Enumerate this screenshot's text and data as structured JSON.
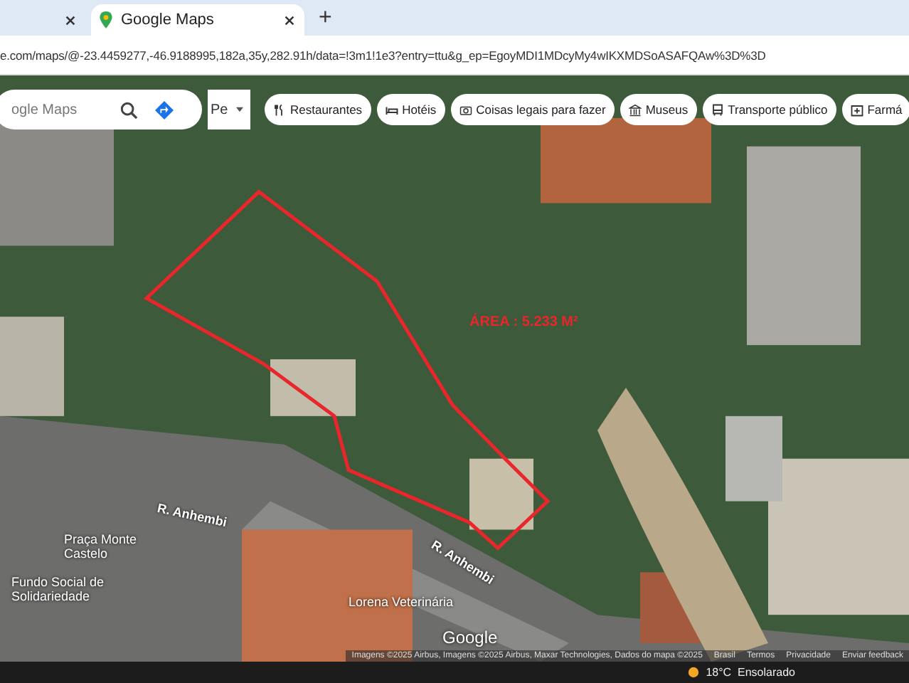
{
  "browser": {
    "tabs": [
      {
        "selected": false
      },
      {
        "title": "Google Maps",
        "selected": true
      }
    ],
    "new_tab": "+",
    "url": "e.com/maps/@-23.4459277,-46.9188995,182a,35y,282.91h/data=!3m1!1e3?entry=ttu&g_ep=EgoyMDI1MDcyMy4wIKXMDSoASAFQAw%3D%3D"
  },
  "map": {
    "search": {
      "placeholder": "ogle Maps"
    },
    "layer_button": "Pe",
    "chips": [
      {
        "label": "Restaurantes",
        "kind": "fork"
      },
      {
        "label": "Hotéis",
        "kind": "bed"
      },
      {
        "label": "Coisas legais para fazer",
        "kind": "camera"
      },
      {
        "label": "Museus",
        "kind": "museum"
      },
      {
        "label": "Transporte público",
        "kind": "bus"
      },
      {
        "label": "Farmá",
        "kind": "pharmacy"
      }
    ],
    "area_label": "ÁREA : 5.233 M²",
    "labels": [
      {
        "text": "R. Anhembi",
        "kind": "street"
      },
      {
        "text": "R. Anhembi",
        "kind": "street"
      },
      {
        "text": "Praça Monte Castelo",
        "kind": "place"
      },
      {
        "text": "Fundo Social de Solidariedade",
        "kind": "poi"
      },
      {
        "text": "Lorena Veterinária",
        "kind": "poi"
      }
    ],
    "logo": "Google",
    "footer": [
      "Imagens ©2025 Airbus, Imagens ©2025 Airbus, Maxar Technologies, Dados do mapa ©2025",
      "Brasil",
      "Termos",
      "Privacidade",
      "Enviar feedback"
    ]
  },
  "taskbar": {
    "weather": "18°C  Ensolarado"
  }
}
